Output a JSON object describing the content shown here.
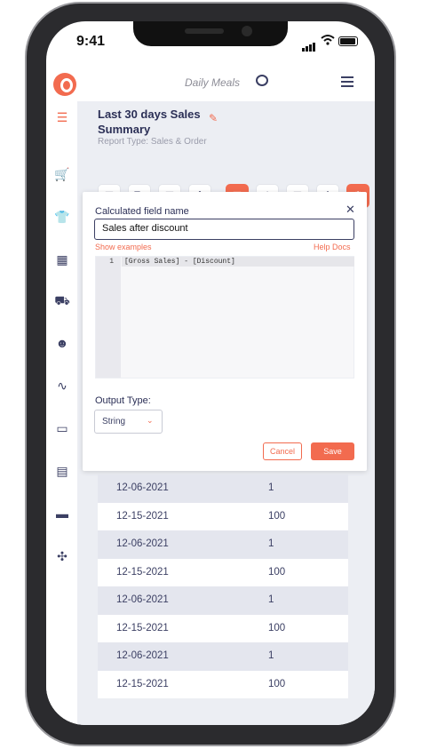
{
  "status_bar": {
    "time": "9:41"
  },
  "app": {
    "title": "Daily Meals"
  },
  "report": {
    "title": "Last 30 days Sales Summary",
    "subtitle": "Report Type: Sales & Order"
  },
  "sidebar": {
    "items": [
      "menu-icon",
      "cart-icon",
      "shirt-icon",
      "boxes-icon",
      "truck-icon",
      "users-icon",
      "route-icon",
      "money-icon",
      "calculator-icon",
      "card-icon",
      "network-icon"
    ]
  },
  "toolbar": {
    "buttons": [
      "table-icon",
      "text-format-icon",
      "filter-icon",
      "sort-icon",
      "save-report-icon",
      "download-icon",
      "calendar-icon",
      "more-icon",
      "settings-icon"
    ]
  },
  "panel": {
    "field_label": "Calculated field name",
    "field_value": "Sales after discount",
    "show_examples": "Show examples",
    "help_docs": "Help Docs",
    "line_number": "1",
    "formula": "[Gross Sales] - [Discount]",
    "output_type_label": "Output Type:",
    "output_type_value": "String",
    "cancel_label": "Cancel",
    "save_label": "Save"
  },
  "table": {
    "rows": [
      {
        "date": "12-06-2021",
        "value": "1"
      },
      {
        "date": "12-15-2021",
        "value": "100"
      },
      {
        "date": "12-06-2021",
        "value": "1"
      },
      {
        "date": "12-15-2021",
        "value": "100"
      },
      {
        "date": "12-06-2021",
        "value": "1"
      },
      {
        "date": "12-15-2021",
        "value": "100"
      },
      {
        "date": "12-06-2021",
        "value": "1"
      },
      {
        "date": "12-15-2021",
        "value": "100"
      }
    ]
  },
  "colors": {
    "accent": "#f26b4f",
    "navy": "#2b2f56",
    "background": "#eceef3"
  }
}
